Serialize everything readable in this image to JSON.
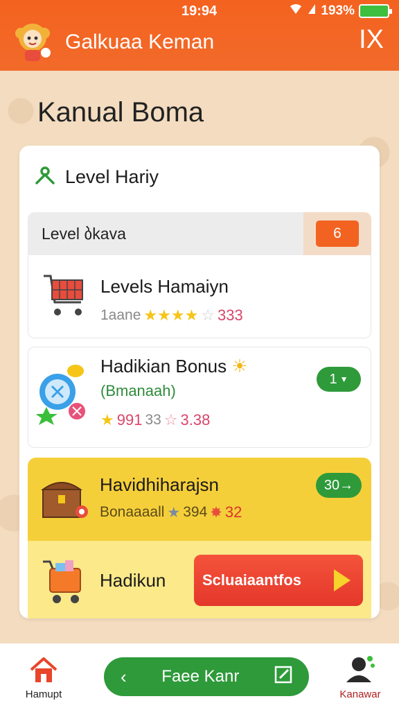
{
  "status": {
    "time": "19:94",
    "battery": "193%"
  },
  "header": {
    "title": "Galkuaa Keman",
    "close_label": "IX"
  },
  "page": {
    "title": "Kanual Boma"
  },
  "card": {
    "header_label": "Level Hariy",
    "section": {
      "label": "Level ბkava",
      "badge": "6"
    },
    "items": [
      {
        "title": "Levels Hamaiyn",
        "meta_prefix": "1aane",
        "stars": "★★★★",
        "empty_star": "☆",
        "value": "333"
      },
      {
        "title": "Hadikian Bonus",
        "sub": "(Bmanaah)",
        "score": "991",
        "score2": "33",
        "value": "3.38",
        "pill": "1"
      },
      {
        "title": "Havidhiharajsn",
        "meta": "Bonaaaall",
        "score": "394",
        "value": "32",
        "pill": "30→"
      },
      {
        "title": "Hadikun",
        "cta": "Scluaiaantfos"
      }
    ]
  },
  "nav": {
    "home_label": "Hamupt",
    "center_label": "Faee Kanr",
    "profile_label": "Kanawar"
  },
  "colors": {
    "brand": "#f4621f",
    "green": "#2e9a3a",
    "yellow": "#f5cf3a"
  }
}
